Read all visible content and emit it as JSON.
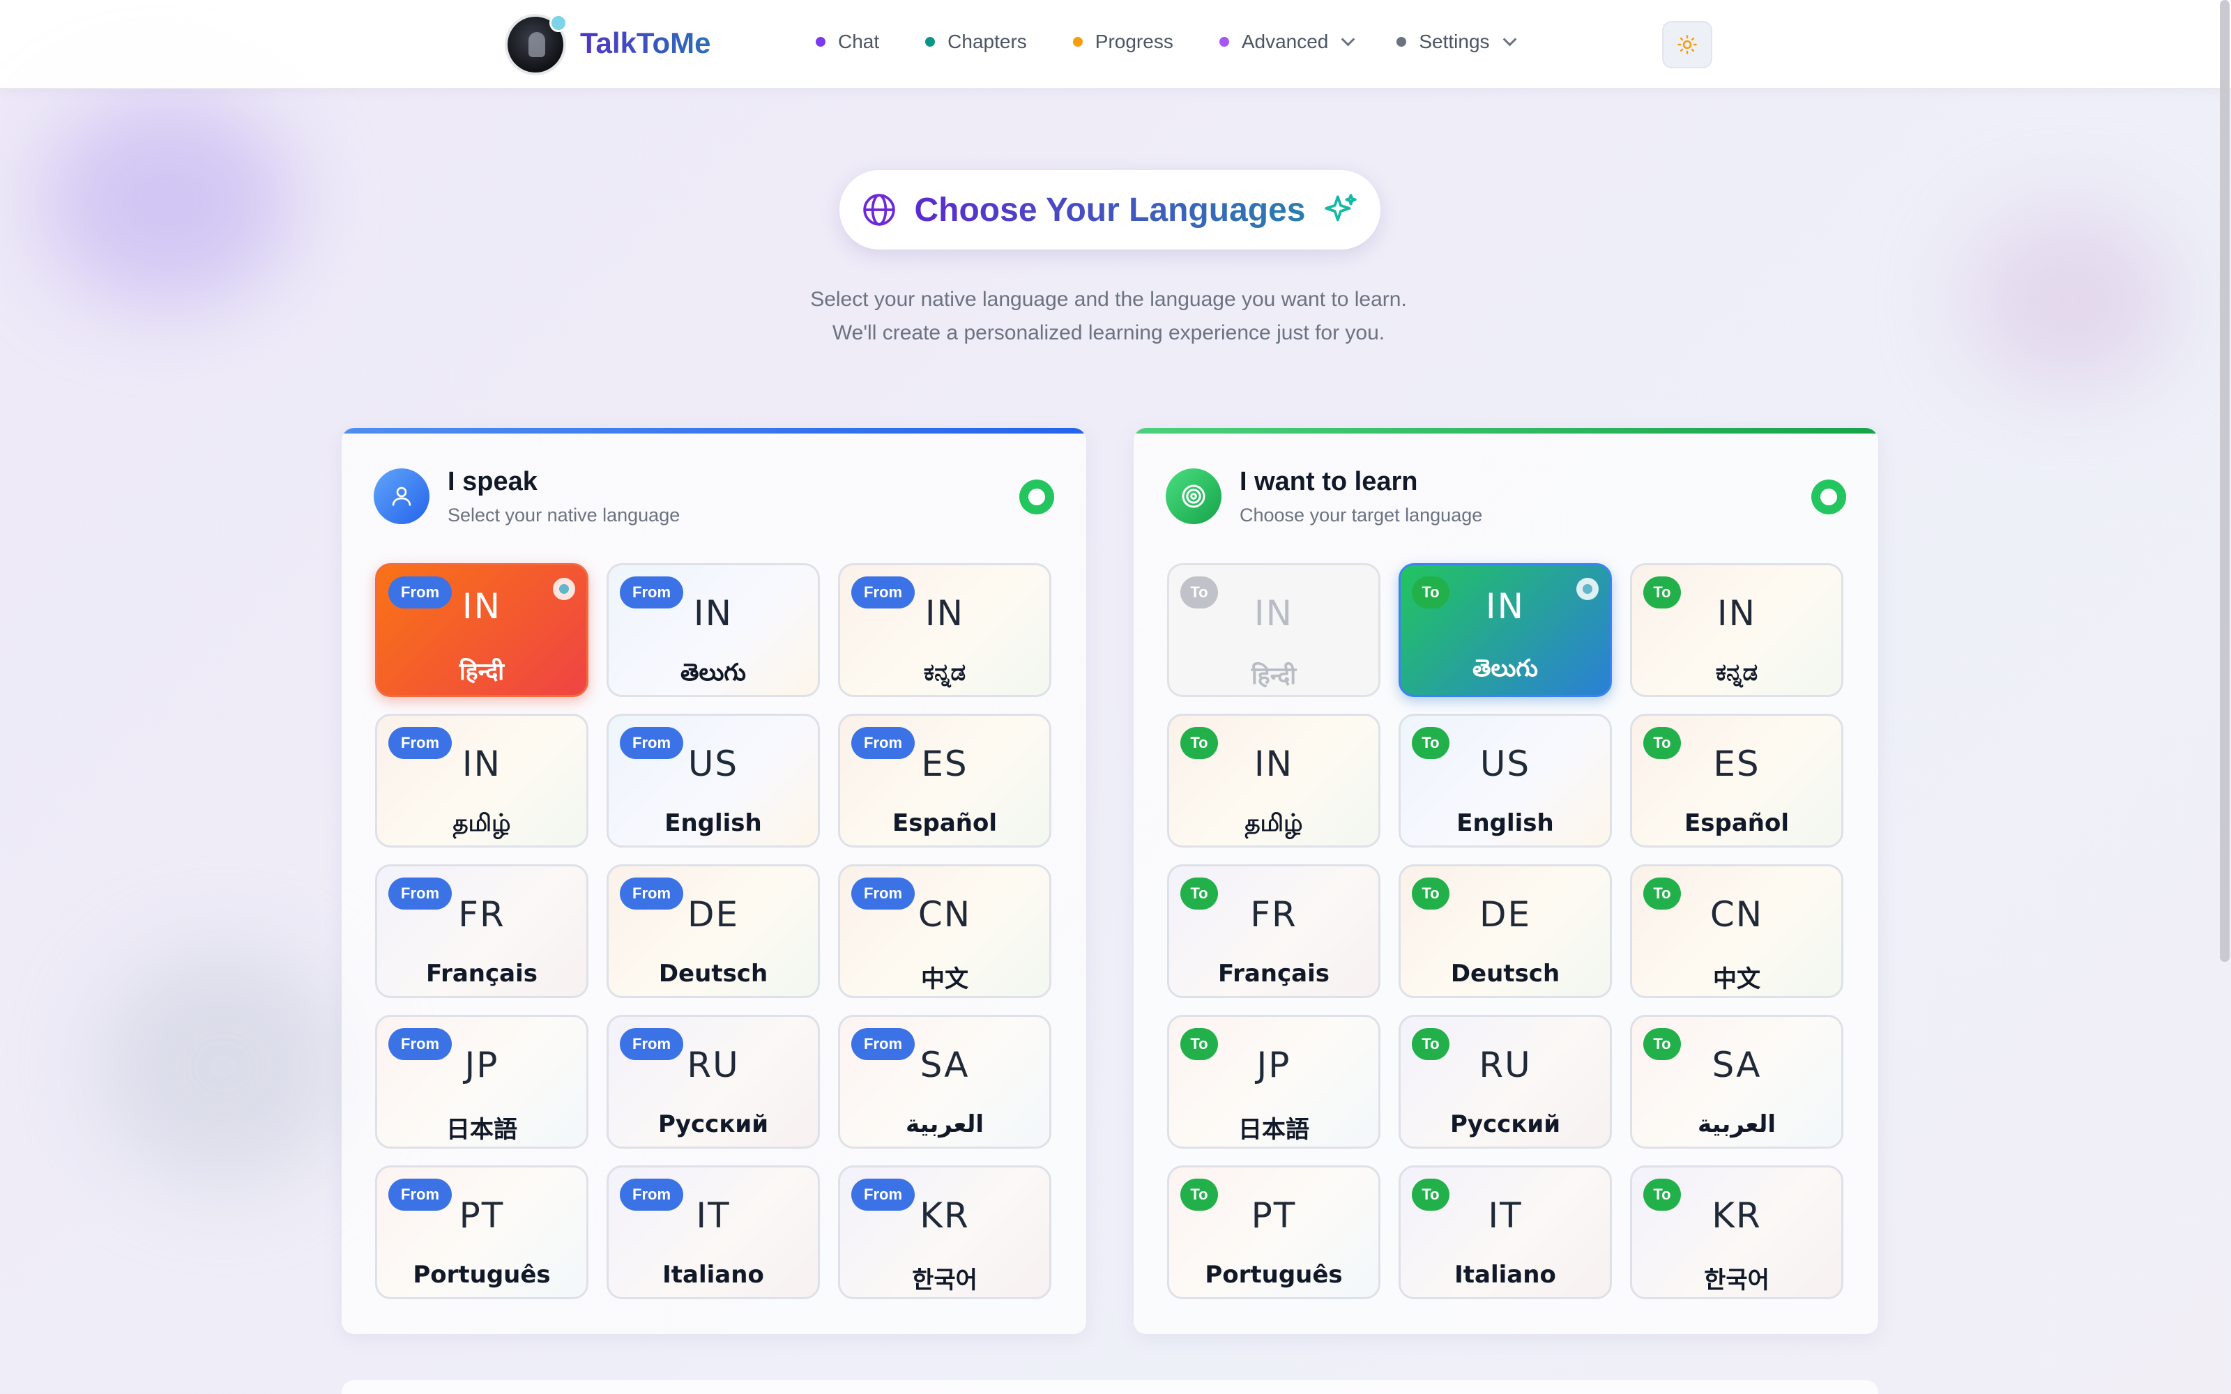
{
  "brand": {
    "name": "TalkToMe"
  },
  "nav": [
    {
      "label": "Chat",
      "color": "#7c3aed",
      "dropdown": false
    },
    {
      "label": "Chapters",
      "color": "#0d9488",
      "dropdown": false
    },
    {
      "label": "Progress",
      "color": "#f59e0b",
      "dropdown": false
    },
    {
      "label": "Advanced",
      "color": "#a855f7",
      "dropdown": true
    },
    {
      "label": "Settings",
      "color": "#6b7280",
      "dropdown": true
    }
  ],
  "hero": {
    "title": "Choose Your Languages",
    "subtitle": "Select your native language and the language you want to learn. We'll create a personalized learning experience just for you."
  },
  "panels": {
    "native": {
      "heading": "I speak",
      "sub": "Select your native language",
      "badge": "From",
      "selected": "हिन्दी"
    },
    "target": {
      "heading": "I want to learn",
      "sub": "Choose your target language",
      "badge": "To",
      "selected": "తెలుగు",
      "disabled": "हिन्दी"
    }
  },
  "languages": [
    {
      "code": "IN",
      "name": "हिन्दी"
    },
    {
      "code": "IN",
      "name": "తెలుగు"
    },
    {
      "code": "IN",
      "name": "ಕನ್ನಡ"
    },
    {
      "code": "IN",
      "name": "தமிழ்"
    },
    {
      "code": "US",
      "name": "English"
    },
    {
      "code": "ES",
      "name": "Español"
    },
    {
      "code": "FR",
      "name": "Français"
    },
    {
      "code": "DE",
      "name": "Deutsch"
    },
    {
      "code": "CN",
      "name": "中文"
    },
    {
      "code": "JP",
      "name": "日本語"
    },
    {
      "code": "RU",
      "name": "Русский"
    },
    {
      "code": "SA",
      "name": "العربية"
    },
    {
      "code": "PT",
      "name": "Português"
    },
    {
      "code": "IT",
      "name": "Italiano"
    },
    {
      "code": "KR",
      "name": "한국어"
    }
  ],
  "colors": {
    "accent_purple": "#5b2bd0",
    "accent_teal": "#2a7db0",
    "from_badge": "#3b73e6",
    "to_badge": "#22b04b",
    "status_ok": "#22c55e"
  },
  "icons": {
    "theme": "sun-icon",
    "title_left": "globe-icon",
    "title_right": "sparkle-icon",
    "native_panel": "user-icon",
    "target_panel": "target-icon"
  }
}
